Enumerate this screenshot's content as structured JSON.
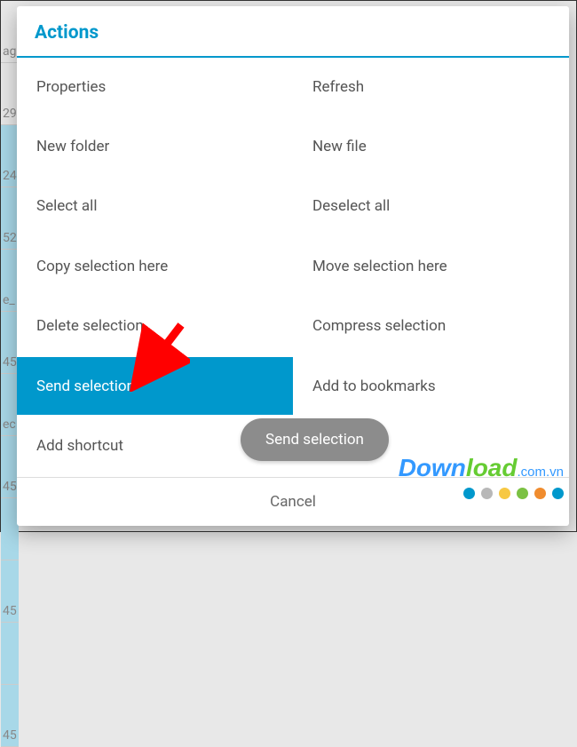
{
  "dialog": {
    "title": "Actions",
    "cancel": "Cancel"
  },
  "menu": {
    "items": [
      {
        "label": "Properties",
        "highlight": false
      },
      {
        "label": "Refresh",
        "highlight": false
      },
      {
        "label": "New folder",
        "highlight": false
      },
      {
        "label": "New file",
        "highlight": false
      },
      {
        "label": "Select all",
        "highlight": false
      },
      {
        "label": "Deselect all",
        "highlight": false
      },
      {
        "label": "Copy selection here",
        "highlight": false
      },
      {
        "label": "Move selection here",
        "highlight": false
      },
      {
        "label": "Delete selection",
        "highlight": false
      },
      {
        "label": "Compress selection",
        "highlight": false
      },
      {
        "label": "Send selection",
        "highlight": true
      },
      {
        "label": "Add to bookmarks",
        "highlight": false
      },
      {
        "label": "Add shortcut",
        "highlight": false
      },
      {
        "label": "",
        "highlight": false
      }
    ]
  },
  "toast": {
    "text": "Send selection"
  },
  "bg": {
    "rows": [
      "ag",
      "29",
      "24",
      "52",
      "e_",
      "45",
      "ec",
      "45",
      "",
      "45",
      "",
      "45"
    ]
  },
  "watermark": {
    "part1": "Down",
    "part2": "load",
    "suffix": ".com.vn",
    "dot_colors": [
      "#0098cc",
      "#b8b8b8",
      "#f7c843",
      "#7bc143",
      "#f08c2e",
      "#0098cc"
    ]
  },
  "colors": {
    "accent": "#0098cc",
    "arrow": "#ff0000"
  }
}
